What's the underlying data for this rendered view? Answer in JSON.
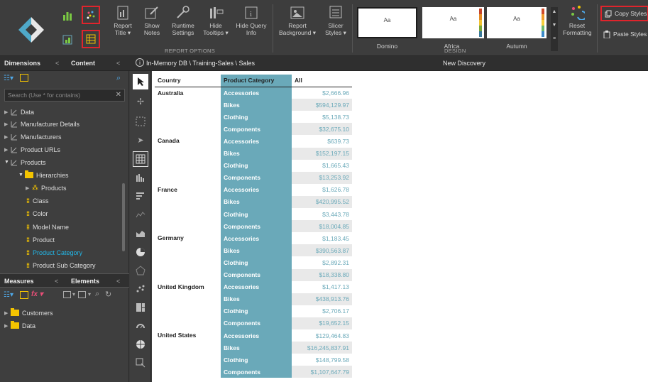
{
  "ribbon": {
    "report_title": "Report\nTitle ▾",
    "show_notes": "Show\nNotes",
    "runtime_settings": "Runtime\nSettings",
    "hide_tooltips": "Hide\nTooltips ▾",
    "hide_query_info": "Hide Query\nInfo",
    "report_options_label": "REPORT OPTIONS",
    "report_background": "Report\nBackground ▾",
    "slicer_styles": "Slicer\nStyles ▾",
    "themes": [
      {
        "sample": "Aa",
        "name": "Domino",
        "stripe": [
          "#3a3a3a",
          "#5a5a5a",
          "#777",
          "#999",
          "#bbb"
        ]
      },
      {
        "sample": "Aa",
        "name": "Africa",
        "stripe": [
          "#c6452a",
          "#e38b22",
          "#f2c230",
          "#7aa83a",
          "#3b7a9a"
        ]
      },
      {
        "sample": "Aa",
        "name": "Autumn",
        "stripe": [
          "#d04b2a",
          "#f09a2a",
          "#f6cf3a",
          "#6bb86b",
          "#3b8ac9"
        ]
      }
    ],
    "design_label": "DESIGN",
    "reset_formatting": "Reset\nFormatting",
    "copy_styles": "Copy Styles",
    "paste_styles": "Paste Styles"
  },
  "subbar": {
    "dimensions_tab": "Dimensions",
    "content_tab": "Content",
    "breadcrumb": "In-Memory DB \\ Training-Sales \\ Sales",
    "discovery_title": "New Discovery"
  },
  "left": {
    "search_placeholder": "Search (Use * for contains)",
    "tree": [
      {
        "label": "Data",
        "type": "dim"
      },
      {
        "label": "Manufacturer Details",
        "type": "dim"
      },
      {
        "label": "Manufacturers",
        "type": "dim"
      },
      {
        "label": "Product URLs",
        "type": "dim"
      },
      {
        "label": "Products",
        "type": "dim-open"
      },
      {
        "label": "Hierarchies",
        "type": "folder-open"
      },
      {
        "label": "Products",
        "type": "hier"
      },
      {
        "label": "Class",
        "type": "attr"
      },
      {
        "label": "Color",
        "type": "attr"
      },
      {
        "label": "Model Name",
        "type": "attr"
      },
      {
        "label": "Product",
        "type": "attr"
      },
      {
        "label": "Product Category",
        "type": "attr-sel"
      },
      {
        "label": "Product Sub Category",
        "type": "attr"
      }
    ],
    "measures_tab": "Measures",
    "elements_tab": "Elements",
    "measure_tree": [
      {
        "label": "Customers"
      },
      {
        "label": "Data"
      }
    ]
  },
  "grid": {
    "headers": {
      "country": "Country",
      "category": "Product Category",
      "value": "All"
    },
    "groups": [
      {
        "country": "Australia",
        "rows": [
          [
            "Accessories",
            "$2,666.96"
          ],
          [
            "Bikes",
            "$594,129.97"
          ],
          [
            "Clothing",
            "$5,138.73"
          ],
          [
            "Components",
            "$32,675.10"
          ]
        ]
      },
      {
        "country": "Canada",
        "rows": [
          [
            "Accessories",
            "$639.73"
          ],
          [
            "Bikes",
            "$152,197.15"
          ],
          [
            "Clothing",
            "$1,665.43"
          ],
          [
            "Components",
            "$13,253.92"
          ]
        ]
      },
      {
        "country": "France",
        "rows": [
          [
            "Accessories",
            "$1,626.78"
          ],
          [
            "Bikes",
            "$420,995.52"
          ],
          [
            "Clothing",
            "$3,443.78"
          ],
          [
            "Components",
            "$18,004.85"
          ]
        ]
      },
      {
        "country": "Germany",
        "rows": [
          [
            "Accessories",
            "$1,183.45"
          ],
          [
            "Bikes",
            "$390,563.87"
          ],
          [
            "Clothing",
            "$2,892.31"
          ],
          [
            "Components",
            "$18,338.80"
          ]
        ]
      },
      {
        "country": "United Kingdom",
        "rows": [
          [
            "Accessories",
            "$1,417.13"
          ],
          [
            "Bikes",
            "$438,913.76"
          ],
          [
            "Clothing",
            "$2,706.17"
          ],
          [
            "Components",
            "$19,652.15"
          ]
        ]
      },
      {
        "country": "United States",
        "rows": [
          [
            "Accessories",
            "$129,464.83"
          ],
          [
            "Bikes",
            "$16,245,837.91"
          ],
          [
            "Clothing",
            "$148,799.58"
          ],
          [
            "Components",
            "$1,107,647.79"
          ]
        ]
      }
    ]
  }
}
